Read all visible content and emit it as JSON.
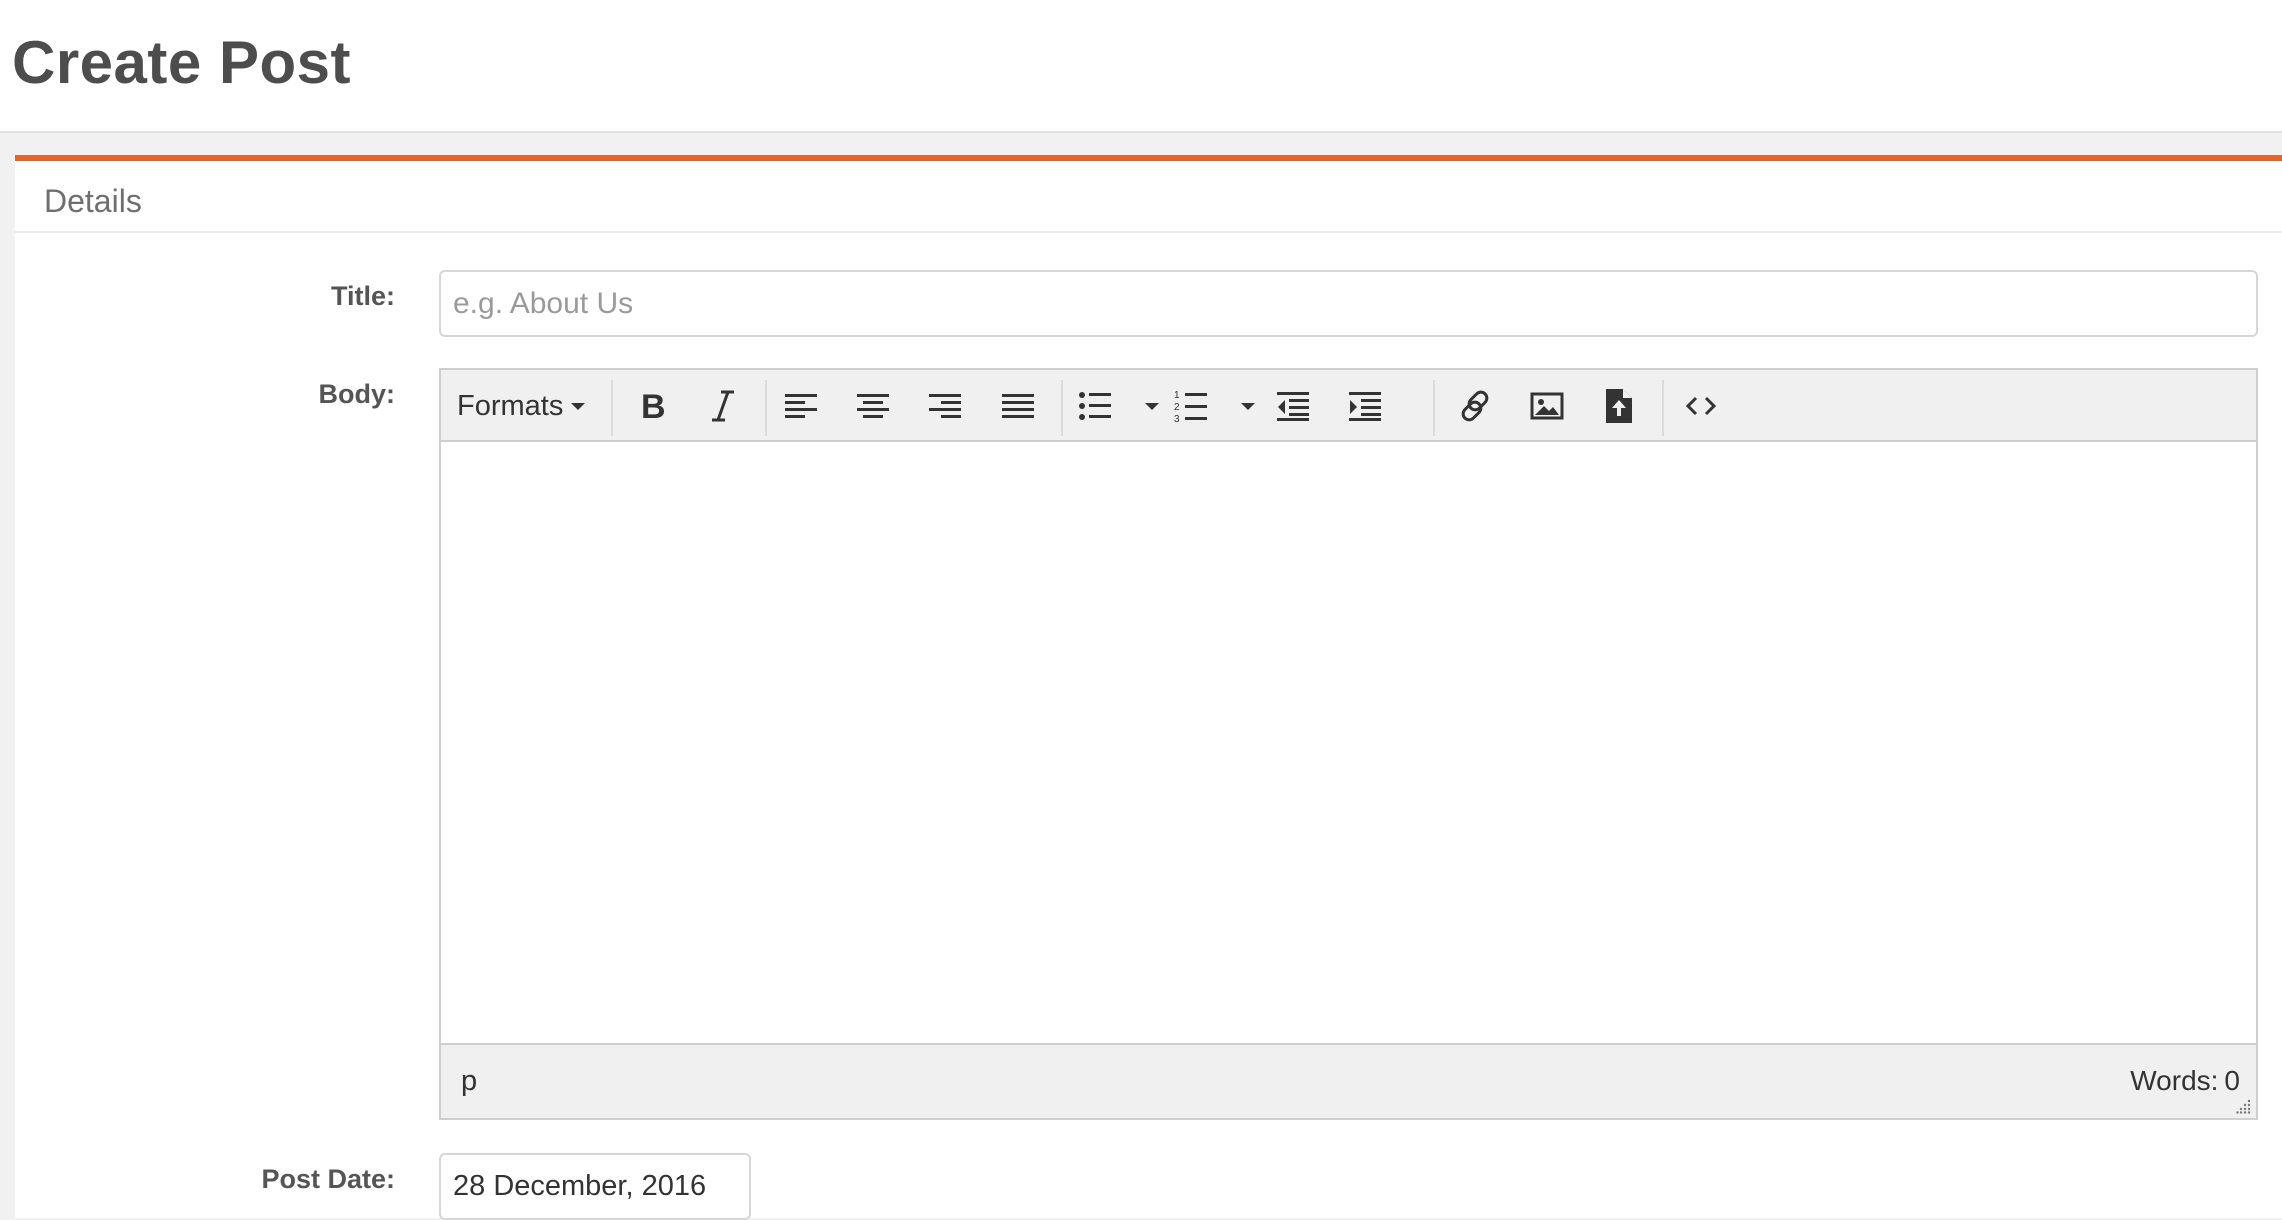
{
  "page": {
    "title": "Create Post"
  },
  "panel": {
    "heading": "Details"
  },
  "form": {
    "title_label": "Title:",
    "title_placeholder": "e.g. About Us",
    "body_label": "Body:",
    "post_date_label": "Post Date:",
    "post_date_value": "28 December, 2016"
  },
  "editor": {
    "formats_label": "Formats",
    "toolbar_icons": [
      "bold-icon",
      "italic-icon",
      "align-left-icon",
      "align-center-icon",
      "align-right-icon",
      "align-justify-icon",
      "bullet-list-icon",
      "numbered-list-icon",
      "outdent-icon",
      "indent-icon",
      "link-icon",
      "image-icon",
      "upload-file-icon",
      "source-code-icon"
    ],
    "path": "p",
    "word_count_label": "Words:",
    "word_count": "0"
  },
  "colors": {
    "accent": "#e4632e",
    "toolbar_bg": "#f0f0f0",
    "page_bg": "#f1f1f1"
  }
}
